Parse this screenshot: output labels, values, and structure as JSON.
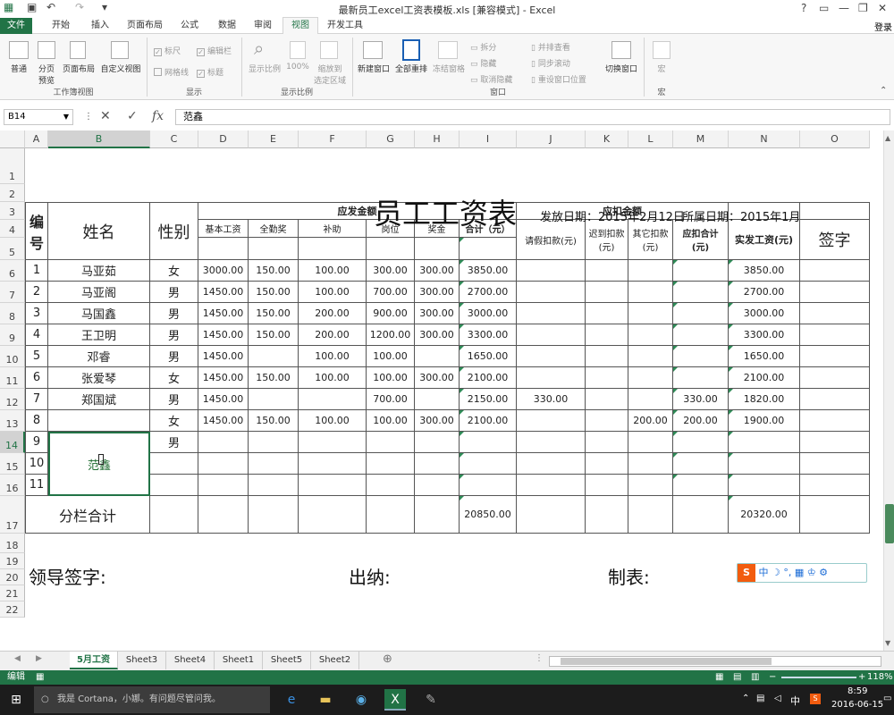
{
  "window": {
    "title": "最新员工excel工资表模板.xls  [兼容模式] - Excel",
    "login": "登录"
  },
  "ribbon_tabs": [
    "文件",
    "开始",
    "插入",
    "页面布局",
    "公式",
    "数据",
    "审阅",
    "视图",
    "开发工具"
  ],
  "ribbon": {
    "workbook_views": {
      "group": "工作簿视图",
      "items": [
        "普通",
        "分页\n预览",
        "页面布局",
        "自定义视图"
      ]
    },
    "show": {
      "group": "显示",
      "items": [
        "标尺",
        "编辑栏",
        "网格线",
        "标题"
      ]
    },
    "zoom": {
      "group": "显示比例",
      "items": [
        "显示比例",
        "100%",
        "缩放到\n选定区域"
      ]
    },
    "window": {
      "group": "窗口",
      "items": [
        "新建窗口",
        "全部重排",
        "冻结窗格",
        "拆分",
        "隐藏",
        "取消隐藏",
        "并排查看",
        "同步滚动",
        "重设窗口位置",
        "切换窗口"
      ]
    },
    "macro": {
      "group": "宏",
      "items": [
        "宏"
      ]
    }
  },
  "formula_bar": {
    "name_box": "B14",
    "content": "范鑫"
  },
  "columns": [
    "A",
    "B",
    "C",
    "D",
    "E",
    "F",
    "G",
    "H",
    "I",
    "J",
    "K",
    "L",
    "M",
    "N",
    "O"
  ],
  "rows": [
    "1",
    "2",
    "3",
    "4",
    "5",
    "6",
    "7",
    "8",
    "9",
    "10",
    "11",
    "12",
    "13",
    "14",
    "15",
    "16",
    "17",
    "18",
    "19",
    "20",
    "21",
    "22"
  ],
  "sheet": {
    "title": "员工工资表",
    "issue_date": "发放日期：2015年2月12日",
    "period": "所属日期：2015年1月",
    "hdr_no": "编\n号",
    "hdr_name": "姓名",
    "hdr_gender": "性别",
    "hdr_payable": "应发金额",
    "hdr_deduct": "应扣金额",
    "hdr_basic": "基本工资",
    "hdr_attend": "全勤奖",
    "hdr_subsidy": "补助",
    "hdr_post": "岗位",
    "hdr_bonus": "奖金",
    "hdr_total": "合计（元）",
    "hdr_leave": "请假扣款(元)",
    "hdr_late": "迟到扣款\n(元)",
    "hdr_other": "其它扣款\n(元)",
    "hdr_dtotal": "应扣合计\n(元)",
    "hdr_net": "实发工资(元)",
    "hdr_sign": "签字",
    "subtotal_label": "分栏合计",
    "subtotal_total": "20850.00",
    "subtotal_net": "20320.00",
    "footer_leader": "领导签字:",
    "footer_cashier": "出纳:",
    "footer_maker": "制表:",
    "employees": [
      {
        "no": "1",
        "name": "马亚茹",
        "gender": "女",
        "basic": "3000.00",
        "attend": "150.00",
        "subsidy": "100.00",
        "post": "300.00",
        "bonus": "300.00",
        "total": "3850.00",
        "leave": "",
        "late": "",
        "other": "",
        "dtotal": "",
        "net": "3850.00"
      },
      {
        "no": "2",
        "name": "马亚阁",
        "gender": "男",
        "basic": "1450.00",
        "attend": "150.00",
        "subsidy": "100.00",
        "post": "700.00",
        "bonus": "300.00",
        "total": "2700.00",
        "leave": "",
        "late": "",
        "other": "",
        "dtotal": "",
        "net": "2700.00"
      },
      {
        "no": "3",
        "name": "马国鑫",
        "gender": "男",
        "basic": "1450.00",
        "attend": "150.00",
        "subsidy": "200.00",
        "post": "900.00",
        "bonus": "300.00",
        "total": "3000.00",
        "leave": "",
        "late": "",
        "other": "",
        "dtotal": "",
        "net": "3000.00"
      },
      {
        "no": "4",
        "name": "王卫明",
        "gender": "男",
        "basic": "1450.00",
        "attend": "150.00",
        "subsidy": "200.00",
        "post": "1200.00",
        "bonus": "300.00",
        "total": "3300.00",
        "leave": "",
        "late": "",
        "other": "",
        "dtotal": "",
        "net": "3300.00"
      },
      {
        "no": "5",
        "name": "邓睿",
        "gender": "男",
        "basic": "1450.00",
        "attend": "",
        "subsidy": "100.00",
        "post": "100.00",
        "bonus": "",
        "total": "1650.00",
        "leave": "",
        "late": "",
        "other": "",
        "dtotal": "",
        "net": "1650.00"
      },
      {
        "no": "6",
        "name": "张爱琴",
        "gender": "女",
        "basic": "1450.00",
        "attend": "150.00",
        "subsidy": "100.00",
        "post": "100.00",
        "bonus": "300.00",
        "total": "2100.00",
        "leave": "",
        "late": "",
        "other": "",
        "dtotal": "",
        "net": "2100.00"
      },
      {
        "no": "7",
        "name": "郑国斌",
        "gender": "男",
        "basic": "1450.00",
        "attend": "",
        "subsidy": "",
        "post": "700.00",
        "bonus": "",
        "total": "2150.00",
        "leave": "330.00",
        "late": "",
        "other": "",
        "dtotal": "330.00",
        "net": "1820.00"
      },
      {
        "no": "8",
        "name": "",
        "gender": "女",
        "basic": "1450.00",
        "attend": "150.00",
        "subsidy": "100.00",
        "post": "100.00",
        "bonus": "300.00",
        "total": "2100.00",
        "leave": "",
        "late": "",
        "other": "200.00",
        "dtotal": "200.00",
        "net": "1900.00"
      },
      {
        "no": "9",
        "name": "范鑫",
        "gender": "男",
        "basic": "",
        "attend": "",
        "subsidy": "",
        "post": "",
        "bonus": "",
        "total": "",
        "leave": "",
        "late": "",
        "other": "",
        "dtotal": "",
        "net": ""
      },
      {
        "no": "10",
        "name": "",
        "gender": "",
        "basic": "",
        "attend": "",
        "subsidy": "",
        "post": "",
        "bonus": "",
        "total": "",
        "leave": "",
        "late": "",
        "other": "",
        "dtotal": "",
        "net": ""
      },
      {
        "no": "11",
        "name": "",
        "gender": "",
        "basic": "",
        "attend": "",
        "subsidy": "",
        "post": "",
        "bonus": "",
        "total": "",
        "leave": "",
        "late": "",
        "other": "",
        "dtotal": "",
        "net": ""
      }
    ]
  },
  "sheet_tabs": [
    "5月工资",
    "Sheet3",
    "Sheet4",
    "Sheet1",
    "Sheet5",
    "Sheet2"
  ],
  "status": {
    "mode": "编辑",
    "zoom": "118%"
  },
  "ime": {
    "label": "中"
  },
  "taskbar": {
    "cortana": "我是 Cortana，小娜。有问题尽管问我。",
    "time": "8:59",
    "date": "2016-06-15",
    "lang": "中"
  },
  "colors": {
    "excel_green": "#217346",
    "cell_marker": "#2e8b57"
  }
}
